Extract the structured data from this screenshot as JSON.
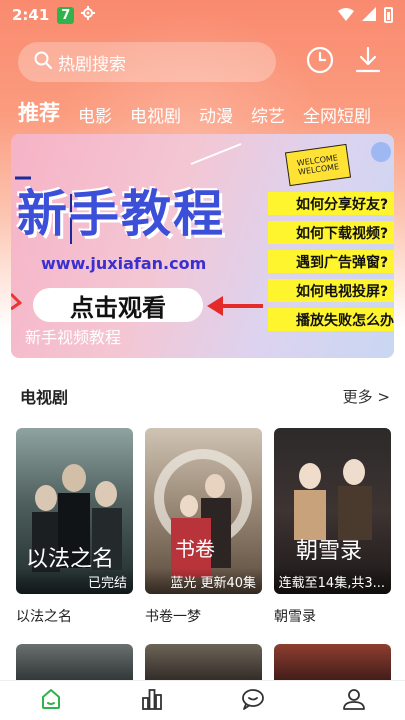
{
  "status_bar": {
    "time": "2:41",
    "app_icon_text": "7",
    "icons": [
      "app-badge-icon",
      "gear-icon",
      "wifi-icon",
      "signal-icon",
      "battery-icon"
    ]
  },
  "search": {
    "placeholder": "热剧搜索",
    "history_icon": "clock-icon",
    "download_icon": "download-icon"
  },
  "tabs": [
    {
      "label": "推荐",
      "active": true
    },
    {
      "label": "电影",
      "active": false
    },
    {
      "label": "电视剧",
      "active": false
    },
    {
      "label": "动漫",
      "active": false
    },
    {
      "label": "综艺",
      "active": false
    },
    {
      "label": "全网短剧",
      "active": false
    }
  ],
  "banner": {
    "title": "新手教程",
    "url": "www.juxiafan.com",
    "cta": "点击观看",
    "caption": "新手视频教程",
    "welcome_top": "WELCOME",
    "welcome_bottom": "WELCOME",
    "faq": [
      "如何分享好友?",
      "如何下载视频?",
      "遇到广告弹窗?",
      "如何电视投屏?",
      "播放失败怎么办"
    ]
  },
  "section": {
    "title": "电视剧",
    "more": "更多 >"
  },
  "cards": [
    {
      "title": "以法之名",
      "status": "已完结",
      "poster_art": "以法之名"
    },
    {
      "title": "书卷一梦",
      "status": "蓝光 更新40集",
      "poster_art": "书卷"
    },
    {
      "title": "朝雪录",
      "status": "连载至14集,共3...",
      "poster_art": "朝雪录"
    }
  ],
  "bottom_nav": [
    {
      "name": "home",
      "icon": "home-icon",
      "active": true
    },
    {
      "name": "rank",
      "icon": "chart-icon",
      "active": false
    },
    {
      "name": "message",
      "icon": "chat-icon",
      "active": false
    },
    {
      "name": "profile",
      "icon": "user-icon",
      "active": false
    }
  ],
  "colors": {
    "accent": "#f98a6f",
    "nav_active": "#2fb34a",
    "banner_title": "#3c4fd8",
    "faq_bg": "#fff52e"
  }
}
